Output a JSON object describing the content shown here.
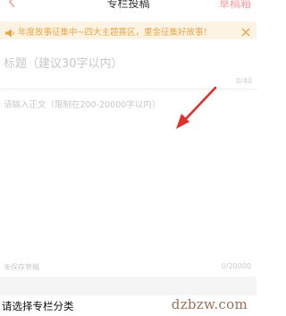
{
  "header": {
    "title": "专栏投稿",
    "drafts_label": "草稿箱",
    "back_icon": "chevron-left-icon"
  },
  "notice": {
    "icon": "megaphone-icon",
    "text": "年度故事征集中~四大主题赛区，重金征集好故事！",
    "close_icon": "close-icon"
  },
  "title_field": {
    "placeholder": "标题（建议30字以内）",
    "value": "",
    "counter": "0/40"
  },
  "body_field": {
    "placeholder": "请输入正文（限制在200-20000字以内）",
    "value": "",
    "counter": "0/20000"
  },
  "status": {
    "save_text": "未保存草稿"
  },
  "category": {
    "label": "请选择专栏分类"
  },
  "annotation": {
    "icon": "red-arrow-icon",
    "color": "#e0302a"
  },
  "watermark": {
    "text": "dzbzw.com"
  },
  "colors": {
    "accent": "#f39c9c",
    "notice_bg": "#fdf3e3",
    "notice_text": "#e7a64a",
    "placeholder": "#c8c8c8"
  }
}
